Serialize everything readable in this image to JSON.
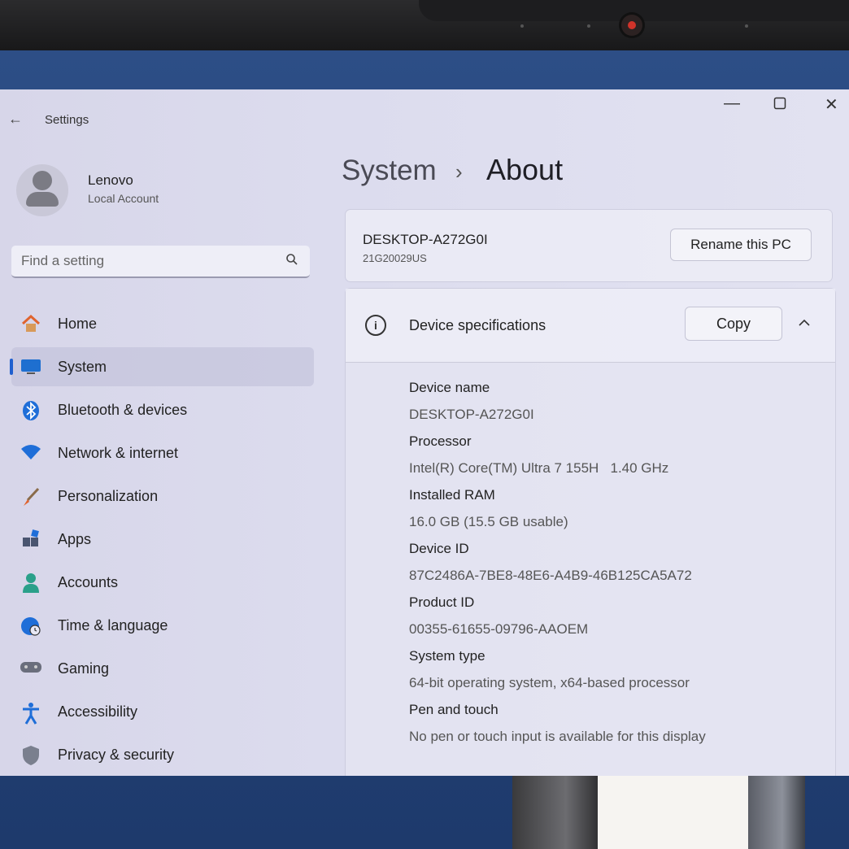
{
  "app": {
    "title": "Settings"
  },
  "profile": {
    "name": "Lenovo",
    "account_type": "Local Account"
  },
  "search": {
    "placeholder": "Find a setting"
  },
  "sidebar": {
    "items": [
      {
        "label": "Home",
        "icon": "home-icon"
      },
      {
        "label": "System",
        "icon": "system-icon",
        "active": true
      },
      {
        "label": "Bluetooth & devices",
        "icon": "bluetooth-icon"
      },
      {
        "label": "Network & internet",
        "icon": "wifi-icon"
      },
      {
        "label": "Personalization",
        "icon": "brush-icon"
      },
      {
        "label": "Apps",
        "icon": "apps-icon"
      },
      {
        "label": "Accounts",
        "icon": "person-icon"
      },
      {
        "label": "Time & language",
        "icon": "globe-clock-icon"
      },
      {
        "label": "Gaming",
        "icon": "controller-icon"
      },
      {
        "label": "Accessibility",
        "icon": "accessibility-icon"
      },
      {
        "label": "Privacy & security",
        "icon": "shield-icon"
      }
    ]
  },
  "breadcrumb": {
    "parent": "System",
    "separator": "›",
    "current": "About"
  },
  "pc": {
    "name": "DESKTOP-A272G0I",
    "model": "21G20029US",
    "rename_label": "Rename this PC"
  },
  "specs": {
    "title": "Device specifications",
    "copy_label": "Copy",
    "rows": [
      {
        "label": "Device name",
        "value": "DESKTOP-A272G0I"
      },
      {
        "label": "Processor",
        "value": "Intel(R) Core(TM) Ultra 7 155H   1.40 GHz"
      },
      {
        "label": "Installed RAM",
        "value": "16.0 GB (15.5 GB usable)"
      },
      {
        "label": "Device ID",
        "value": "87C2486A-7BE8-48E6-A4B9-46B125CA5A72"
      },
      {
        "label": "Product ID",
        "value": "00355-61655-09796-AAOEM"
      },
      {
        "label": "System type",
        "value": "64-bit operating system, x64-based processor"
      },
      {
        "label": "Pen and touch",
        "value": "No pen or touch input is available for this display"
      }
    ]
  },
  "colors": {
    "accent": "#1f5fcf",
    "window_bg": "#dcdcee"
  }
}
